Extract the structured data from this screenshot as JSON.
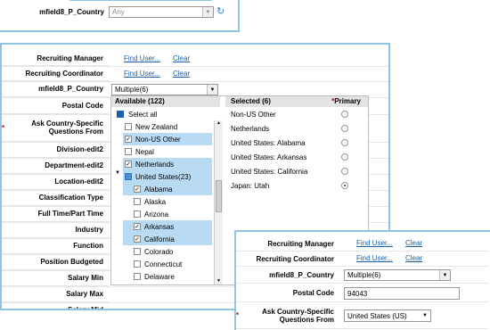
{
  "top_panel": {
    "country_label": "mfield8_P_Country",
    "country_value": "Any",
    "refresh_icon": "refresh-icon"
  },
  "main_panel": {
    "rows": [
      {
        "label": "Recruiting Manager",
        "required": false
      },
      {
        "label": "Recruiting Coordinator",
        "required": false
      },
      {
        "label": "mfield8_P_Country",
        "required": false
      },
      {
        "label": "Postal Code",
        "required": false
      },
      {
        "label": "Ask Country-Specific Questions From",
        "required": true
      },
      {
        "label": "Division-edit2",
        "required": false
      },
      {
        "label": "Department-edit2",
        "required": false
      },
      {
        "label": "Location-edit2",
        "required": false
      },
      {
        "label": "Classification Type",
        "required": false
      },
      {
        "label": "Full Time/Part Time",
        "required": false
      },
      {
        "label": "Industry",
        "required": false
      },
      {
        "label": "Function",
        "required": false
      },
      {
        "label": "Position Budgeted",
        "required": false
      },
      {
        "label": "Salary Min",
        "required": false
      },
      {
        "label": "Salary Max",
        "required": false
      },
      {
        "label": "Salary Mid",
        "required": false
      }
    ],
    "find_user_label": "Find User...",
    "clear_label": "Clear",
    "country_select_value": "Multiple(6)"
  },
  "picker": {
    "available_header": "Available (122)",
    "selected_header": "Selected (6)",
    "primary_header": "Primary",
    "select_all_label": "Select all",
    "available_items": [
      {
        "label": "New Zealand",
        "checked": false,
        "highlight": false,
        "indent": 0
      },
      {
        "label": "Non-US Other",
        "checked": true,
        "highlight": true,
        "indent": 0
      },
      {
        "label": "Nepal",
        "checked": false,
        "highlight": false,
        "indent": 0
      },
      {
        "label": "Netherlands",
        "checked": true,
        "highlight": true,
        "indent": 0
      },
      {
        "label": "United States(23)",
        "checked": false,
        "highlight": true,
        "indent": 0,
        "group": true
      },
      {
        "label": "Alabama",
        "checked": true,
        "highlight": true,
        "indent": 1
      },
      {
        "label": "Alaska",
        "checked": false,
        "highlight": false,
        "indent": 1
      },
      {
        "label": "Arizona",
        "checked": false,
        "highlight": false,
        "indent": 1
      },
      {
        "label": "Arkansas",
        "checked": true,
        "highlight": true,
        "indent": 1
      },
      {
        "label": "California",
        "checked": true,
        "highlight": true,
        "indent": 1
      },
      {
        "label": "Colorado",
        "checked": false,
        "highlight": false,
        "indent": 1
      },
      {
        "label": "Connecticut",
        "checked": false,
        "highlight": false,
        "indent": 1
      },
      {
        "label": "Delaware",
        "checked": false,
        "highlight": false,
        "indent": 1
      }
    ],
    "selected_items": [
      {
        "label": "Non-US Other",
        "primary": false
      },
      {
        "label": "Netherlands",
        "primary": false
      },
      {
        "label": "United States: Alabama",
        "primary": false
      },
      {
        "label": "United States: Arkansas",
        "primary": false
      },
      {
        "label": "United States: California",
        "primary": false
      },
      {
        "label": "Japan: Utah",
        "primary": true
      }
    ]
  },
  "overlay_panel": {
    "rows": [
      {
        "label": "Recruiting Manager",
        "required": false
      },
      {
        "label": "Recruiting Coordinator",
        "required": false
      },
      {
        "label": "mfield8_P_Country",
        "required": false
      },
      {
        "label": "Postal Code",
        "required": false
      },
      {
        "label": "Ask Country-Specific Questions From",
        "required": true
      }
    ],
    "find_user_label": "Find User...",
    "clear_label": "Clear",
    "country_select_value": "Multiple(6)",
    "postal_code_value": "94043",
    "ask_from_value": "United States (US)"
  },
  "colors": {
    "border": "#8fc4e4",
    "highlight": "#b8daf2",
    "link": "#1a5fa8",
    "required": "#cc0000"
  }
}
